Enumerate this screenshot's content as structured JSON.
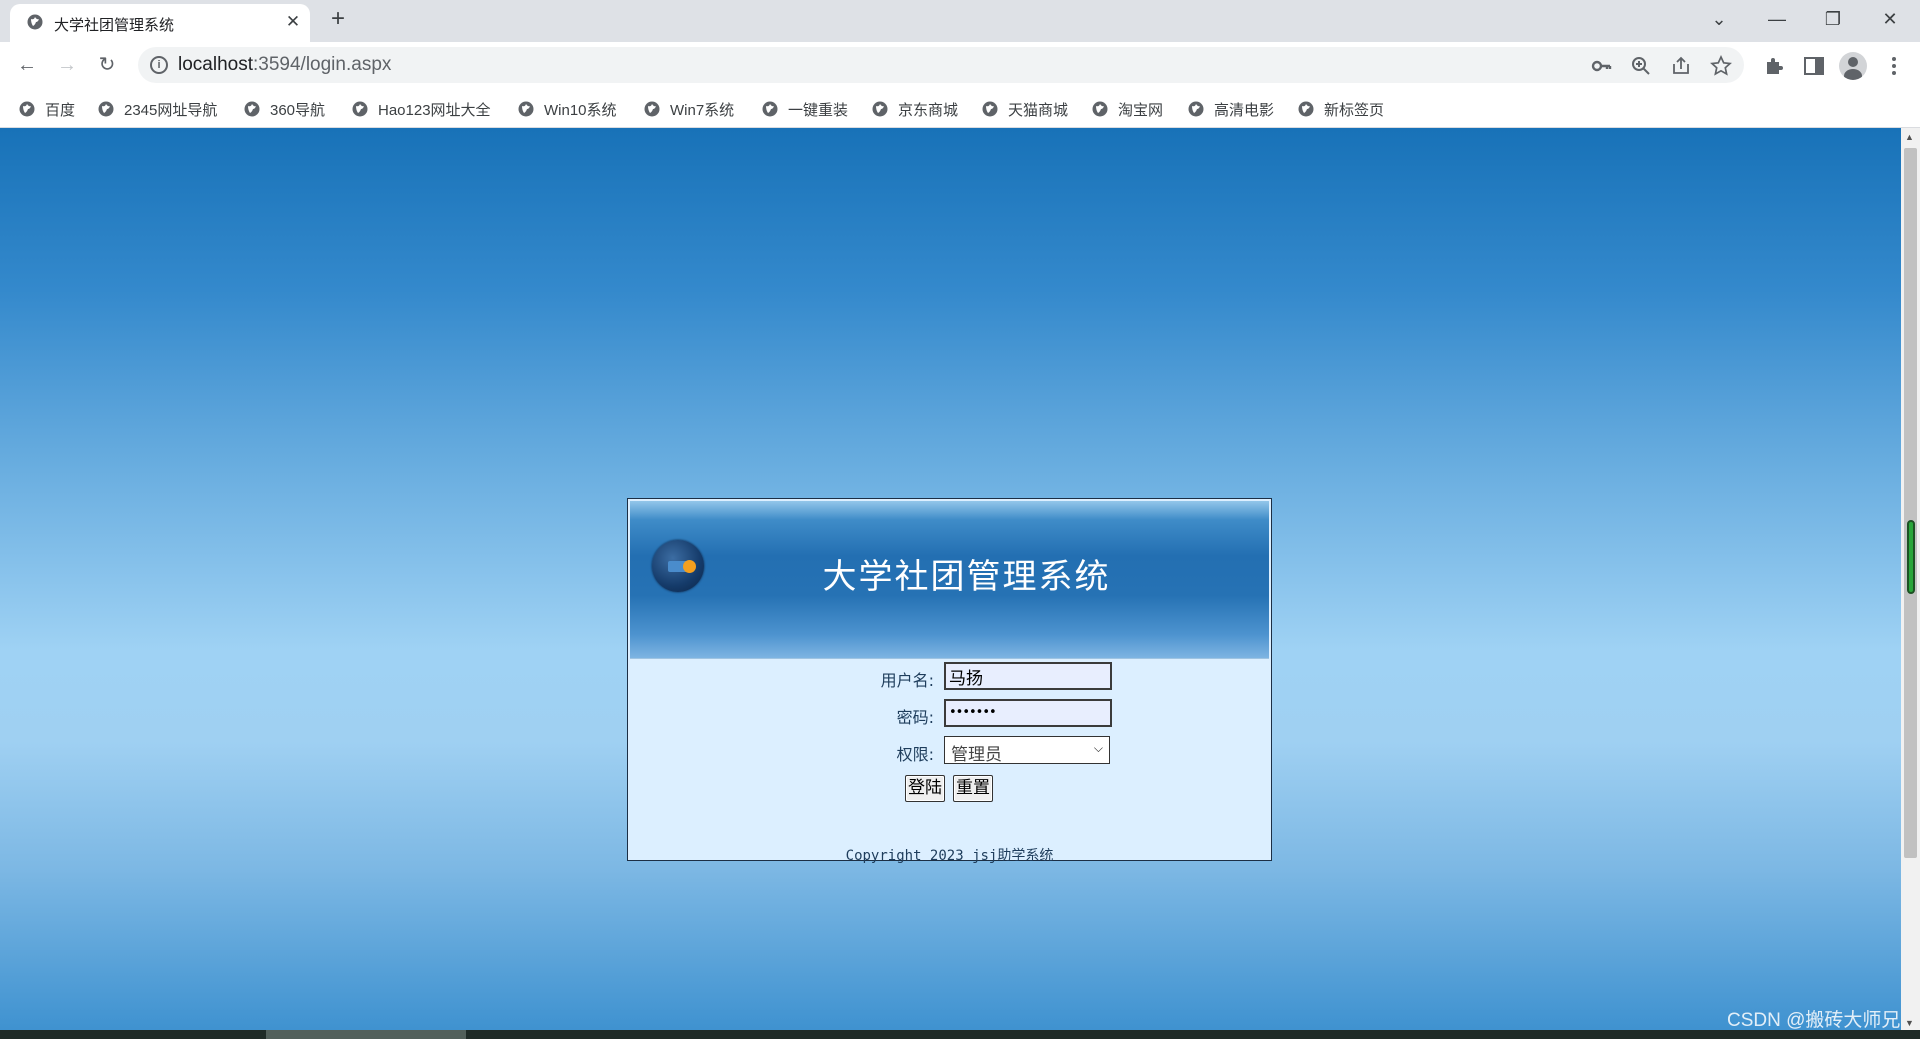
{
  "browser": {
    "tab_title": "大学社团管理系统",
    "tab_close": "✕",
    "new_tab": "+",
    "url_host": "localhost",
    "url_path": ":3594/login.aspx",
    "window_controls": {
      "tabsearch": "⌄",
      "minimize": "—",
      "restore": "❐",
      "close": "✕"
    },
    "nav": {
      "back": "←",
      "forward": "→",
      "reload": "↻"
    },
    "bookmarks": [
      {
        "label": "百度"
      },
      {
        "label": "2345网址导航"
      },
      {
        "label": "360导航"
      },
      {
        "label": "Hao123网址大全"
      },
      {
        "label": "Win10系统"
      },
      {
        "label": "Win7系统"
      },
      {
        "label": "一键重装"
      },
      {
        "label": "京东商城"
      },
      {
        "label": "天猫商城"
      },
      {
        "label": "淘宝网"
      },
      {
        "label": "高清电影"
      },
      {
        "label": "新标签页"
      }
    ]
  },
  "login": {
    "title": "大学社团管理系统",
    "username_label": "用户名:",
    "username_value": "马扬",
    "password_label": "密码:",
    "password_value": "•••••••",
    "role_label": "权限:",
    "role_selected": "管理员",
    "login_button": "登陆",
    "reset_button": "重置",
    "copyright": "Copyright 2023 jsj助学系统"
  },
  "watermark": "CSDN @搬砖大师兄",
  "colors": {
    "accent": "#236fb2",
    "form_bg": "#dcefff",
    "logo_dot": "#f5a01f"
  }
}
